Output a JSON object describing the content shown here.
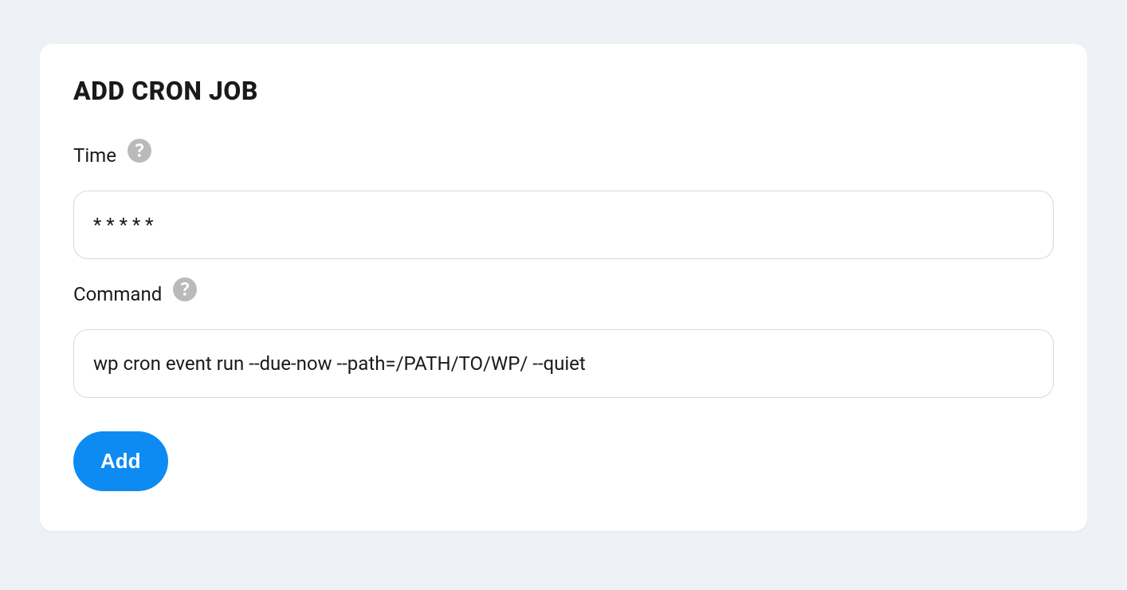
{
  "form": {
    "title": "ADD CRON JOB",
    "fields": {
      "time": {
        "label": "Time",
        "value": "* * * * *"
      },
      "command": {
        "label": "Command",
        "value": "wp cron event run --due-now --path=/PATH/TO/WP/ --quiet"
      }
    },
    "submit_label": "Add"
  }
}
